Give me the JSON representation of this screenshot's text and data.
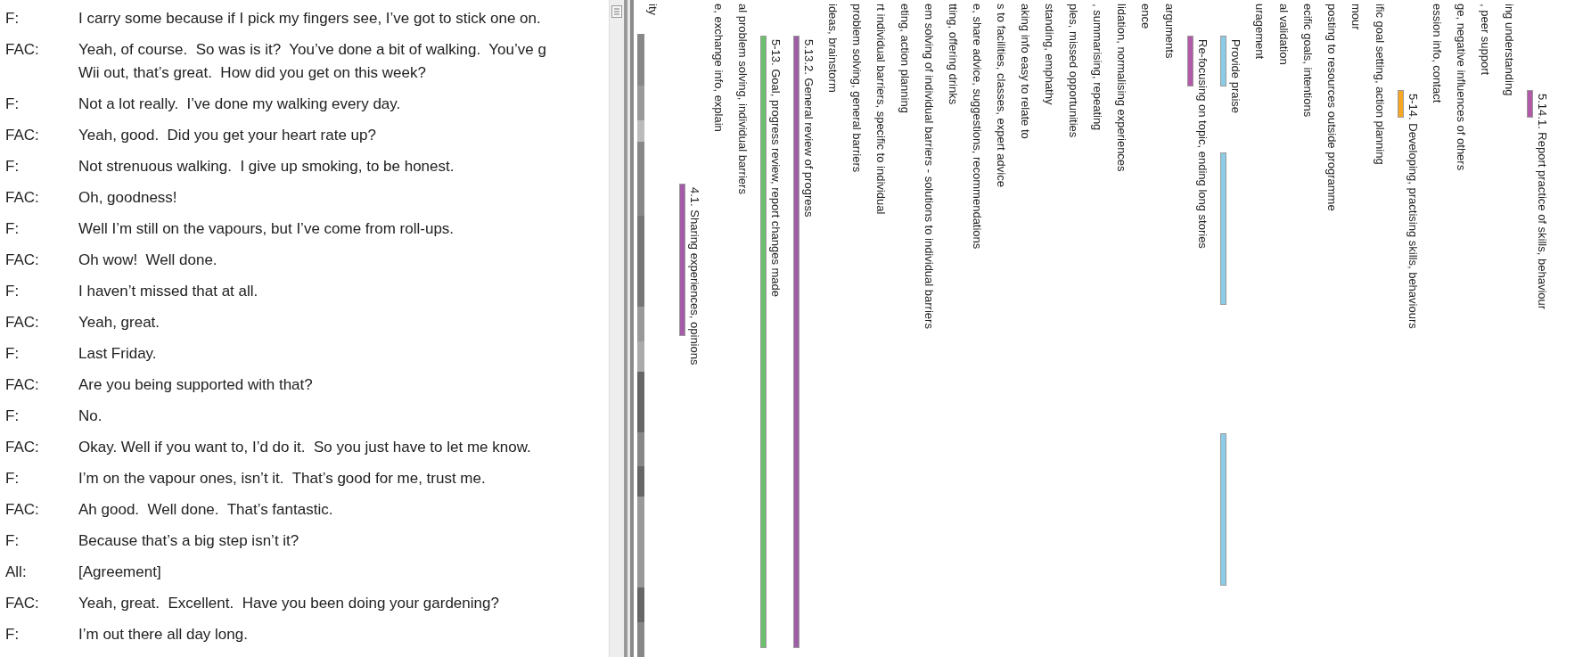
{
  "transcript": [
    {
      "speaker": "F:",
      "lines": [
        "I carry some because if I pick my fingers see, I’ve got to stick one on."
      ]
    },
    {
      "speaker": "FAC:",
      "lines": [
        "Yeah, of course.  So was is it?  You’ve done a bit of walking.  You’ve g",
        "Wii out, that’s great.  How did you get on this week?"
      ]
    },
    {
      "speaker": "F:",
      "lines": [
        "Not a lot really.  I’ve done my walking every day."
      ]
    },
    {
      "speaker": "FAC:",
      "lines": [
        "Yeah, good.  Did you get your heart rate up?"
      ]
    },
    {
      "speaker": "F:",
      "lines": [
        "Not strenuous walking.  I give up smoking, to be honest."
      ]
    },
    {
      "speaker": "FAC:",
      "lines": [
        "Oh, goodness!"
      ]
    },
    {
      "speaker": "F:",
      "lines": [
        "Well I’m still on the vapours, but I’ve come from roll-ups."
      ]
    },
    {
      "speaker": "FAC:",
      "lines": [
        "Oh wow!  Well done."
      ]
    },
    {
      "speaker": "F:",
      "lines": [
        "I haven’t missed that at all."
      ]
    },
    {
      "speaker": "FAC:",
      "lines": [
        "Yeah, great."
      ]
    },
    {
      "speaker": "F:",
      "lines": [
        "Last Friday."
      ]
    },
    {
      "speaker": "FAC:",
      "lines": [
        "Are you being supported with that?"
      ]
    },
    {
      "speaker": "F:",
      "lines": [
        "No."
      ]
    },
    {
      "speaker": "FAC:",
      "lines": [
        "Okay. Well if you want to, I’d do it.  So you just have to let me know."
      ]
    },
    {
      "speaker": "F:",
      "lines": [
        "I’m on the vapour ones, isn’t it.  That’s good for me, trust me."
      ]
    },
    {
      "speaker": "FAC:",
      "lines": [
        "Ah good.  Well done.  That’s fantastic."
      ]
    },
    {
      "speaker": "F:",
      "lines": [
        "Because that’s a big step isn’t it?"
      ]
    },
    {
      "speaker": "All:",
      "lines": [
        "[Agreement]"
      ]
    },
    {
      "speaker": "FAC:",
      "lines": [
        "Yeah, great.  Excellent.  Have you been doing your gardening?"
      ]
    },
    {
      "speaker": "F:",
      "lines": [
        "I’m out there all day long."
      ]
    }
  ],
  "density_label": "ity",
  "codes": [
    {
      "kind": "stripe",
      "label": "4.1. Sharing experiences, opinions",
      "color": "#a55ca8",
      "coverage": [
        false,
        false,
        false,
        false,
        false,
        true,
        true,
        true,
        true,
        true,
        false,
        false,
        false,
        false,
        false,
        false,
        false,
        false,
        false,
        false
      ]
    },
    {
      "kind": "plain",
      "label": "e, exchange info, explain"
    },
    {
      "kind": "plain",
      "label": "al problem solving, individual barriers"
    },
    {
      "kind": "stripe",
      "label": "5-13. Goal, progress review, report changes made",
      "color": "#6cbf6c",
      "coverage": [
        false,
        true,
        true,
        true,
        true,
        true,
        true,
        true,
        true,
        true,
        true,
        true,
        true,
        true,
        true,
        true,
        true,
        true,
        true,
        true
      ]
    },
    {
      "kind": "stripe",
      "label": "5.13.2. General review of progress",
      "color": "#9e5ea6",
      "coverage": [
        false,
        true,
        true,
        true,
        true,
        true,
        true,
        true,
        true,
        true,
        true,
        true,
        true,
        true,
        true,
        true,
        true,
        true,
        true,
        true
      ]
    },
    {
      "kind": "plain",
      "label": "ideas, brainstorm"
    },
    {
      "kind": "plain",
      "label": "problem solving, general barriers"
    },
    {
      "kind": "plain",
      "label": "rt individual barriers, specific to individual"
    },
    {
      "kind": "plain",
      "label": "eting, action planning"
    },
    {
      "kind": "plain",
      "label": "em solving of individual barriers - solutions to individual barriers"
    },
    {
      "kind": "plain",
      "label": "tting, offering drinks"
    },
    {
      "kind": "plain",
      "label": "e, share advice, suggestions, recommendations"
    },
    {
      "kind": "plain",
      "label": "s to facilities, classes, expert advice"
    },
    {
      "kind": "plain",
      "label": "aking info easy to relate to"
    },
    {
      "kind": "plain",
      "label": "standing, emphathy"
    },
    {
      "kind": "plain",
      "label": "ples, missed opportunities"
    },
    {
      "kind": "plain",
      "label": ", summarising, repeating"
    },
    {
      "kind": "plain",
      "label": "lidation, normalising experiences"
    },
    {
      "kind": "plain",
      "label": "ence"
    },
    {
      "kind": "plain",
      "label": "arguments"
    },
    {
      "kind": "stripe",
      "label": "Re-focusing on topic, ending long stories",
      "color": "#b05aa8",
      "coverage": [
        false,
        true,
        false,
        false,
        false,
        false,
        false,
        false,
        false,
        false,
        false,
        false,
        false,
        false,
        false,
        false,
        false,
        false,
        false,
        false
      ]
    },
    {
      "kind": "stripe",
      "label": "Provide praise",
      "color": "#8ccbe6",
      "coverage": [
        false,
        true,
        false,
        false,
        true,
        true,
        true,
        true,
        true,
        false,
        false,
        false,
        false,
        true,
        true,
        true,
        true,
        true,
        false,
        false
      ]
    },
    {
      "kind": "plain",
      "label": "uragement"
    },
    {
      "kind": "plain",
      "label": "al validation"
    },
    {
      "kind": "plain",
      "label": "ecific goals, intentions"
    },
    {
      "kind": "plain",
      "label": "posting to resources outside programme"
    },
    {
      "kind": "plain",
      "label": "mour"
    },
    {
      "kind": "plain",
      "label": "ific goal setting, action planning"
    },
    {
      "kind": "stripe",
      "label": "5-14. Developing, practising skills, behaviours",
      "color": "#f5a623",
      "coverage": [
        false,
        false,
        true,
        false,
        false,
        false,
        false,
        false,
        false,
        false,
        false,
        false,
        false,
        false,
        false,
        false,
        false,
        false,
        false,
        false
      ]
    },
    {
      "kind": "plain",
      "label": "ession info, contact"
    },
    {
      "kind": "plain",
      "label": "ge, negative influences of others"
    },
    {
      "kind": "plain",
      "label": ", peer support"
    },
    {
      "kind": "plain",
      "label": "ing understanding"
    },
    {
      "kind": "stripe",
      "label": "5.14.1. Report practice of skills, behaviour",
      "color": "#b05aa8",
      "coverage": [
        false,
        false,
        true,
        false,
        false,
        false,
        false,
        false,
        false,
        false,
        false,
        false,
        false,
        false,
        false,
        false,
        false,
        false,
        false,
        false
      ]
    }
  ]
}
